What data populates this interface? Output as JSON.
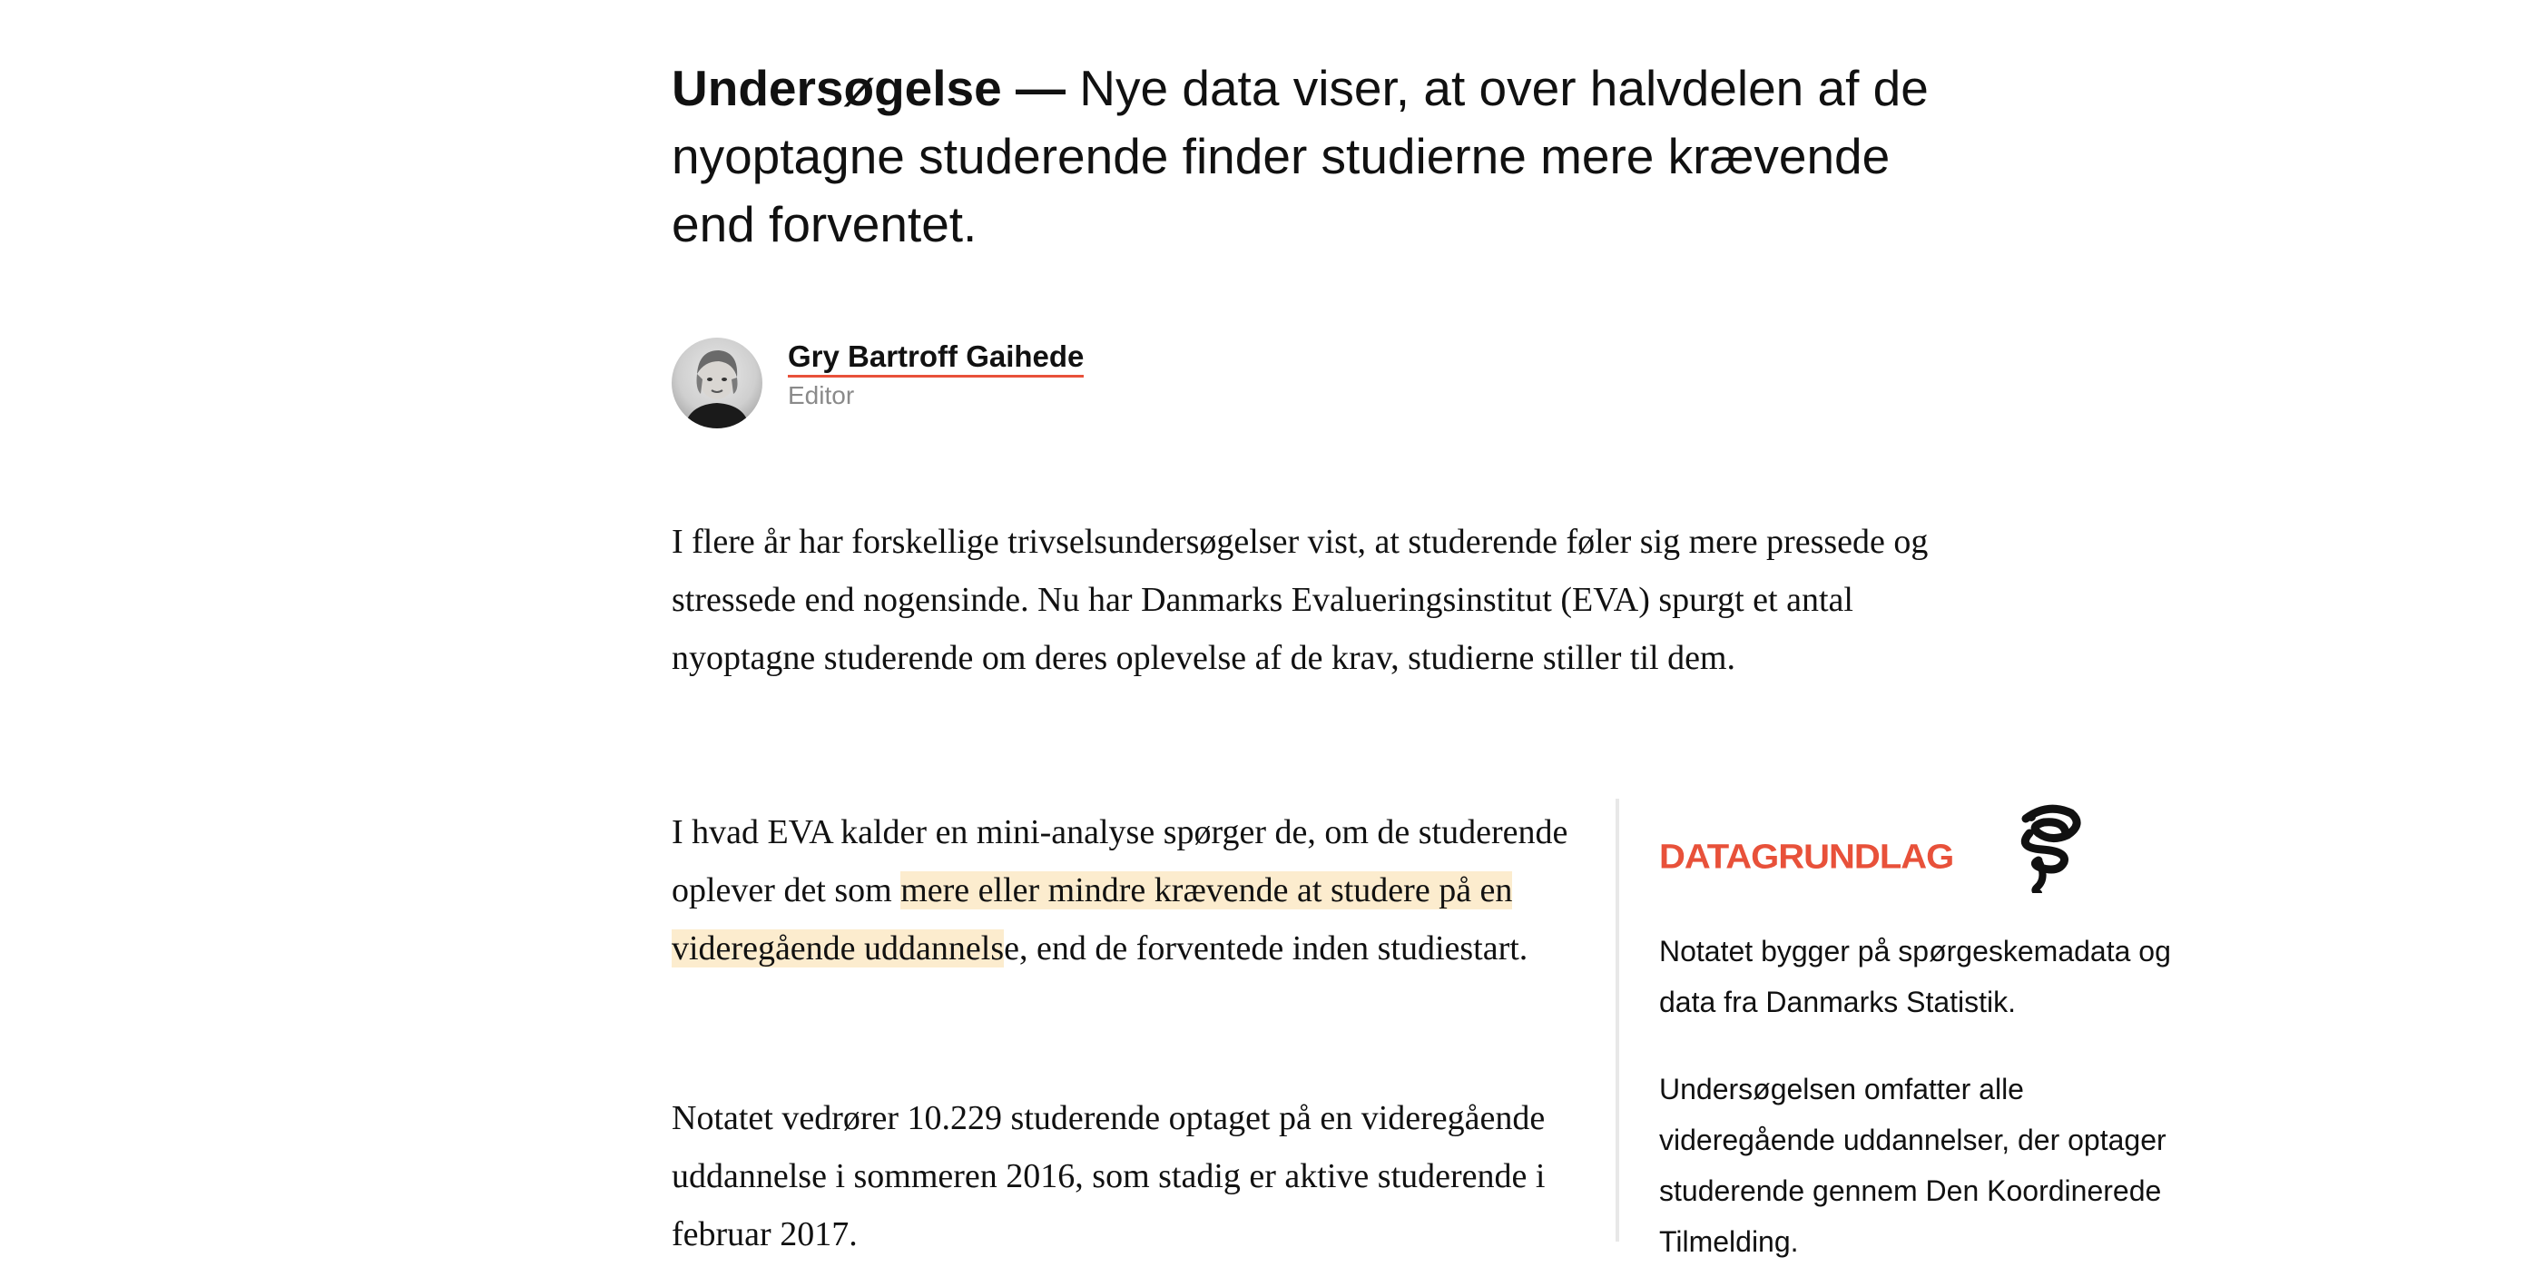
{
  "article": {
    "lede_kicker": "Undersøgelse —",
    "lede_text": " Nye data viser, at over halvdelen af de nyoptagne studerende finder studierne mere krævende end forventet."
  },
  "byline": {
    "author_name": "Gry Bartroff Gaihede",
    "author_role": "Editor"
  },
  "body": {
    "p1": "I flere år har forskellige trivselsundersøgelser vist, at studerende føler sig mere pressede og stressede end nogensinde. Nu har Danmarks Evalueringsinstitut (EVA) spurgt et antal nyoptagne studerende om deres oplevelse af de krav, studierne stiller til dem.",
    "p2_before": "I hvad EVA kalder en mini-analyse spørger de, om de studerende oplever det som ",
    "p2_highlight": "mere eller mindre krævende at studere på en videregående uddannels",
    "p2_after": "e, end de forventede inden studiestart.",
    "p3": "Notatet vedrører 10.229 studerende optaget på en videregående uddannelse i sommeren 2016, som stadig er aktive studerende i februar 2017."
  },
  "factbox": {
    "title": "DATAGRUNDLAG",
    "logo_icon": "serpent-logo-icon",
    "p1": "Notatet bygger på spørgeskemadata og data fra Danmarks Statistik.",
    "p2": "Undersøgelsen omfatter alle videregående uddannelser, der optager studerende gennem Den Koordinerede Tilmelding."
  },
  "colors": {
    "accent": "#e8513a",
    "highlight": "#fcecce",
    "divider": "#e8e8e8",
    "muted": "#8a8a8a"
  }
}
